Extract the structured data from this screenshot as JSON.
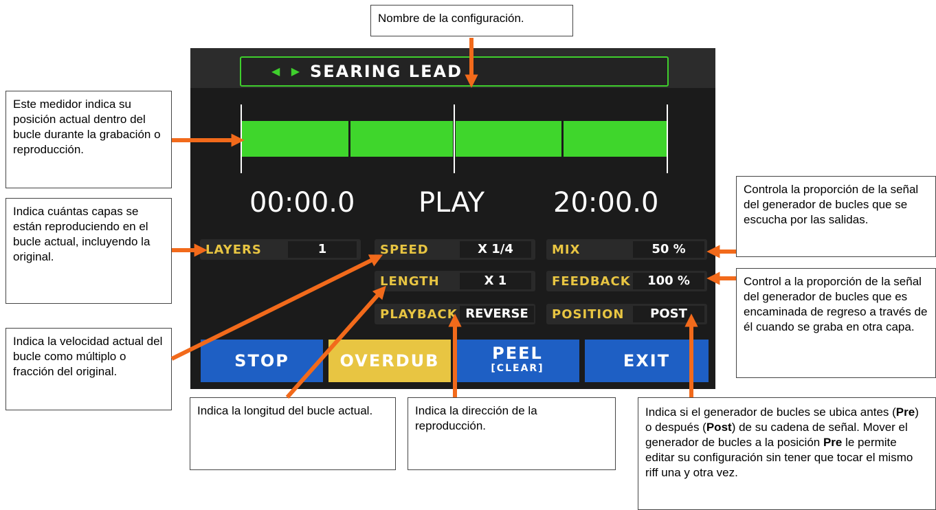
{
  "device": {
    "nav_arrows": "◀ ▶",
    "preset_name": "SEARING LEAD",
    "time_start": "00:00.0",
    "status": "PLAY",
    "time_end": "20:00.0",
    "params": [
      {
        "label": "LAYERS",
        "value": "1"
      },
      {
        "label": "SPEED",
        "value": "X 1/4"
      },
      {
        "label": "MIX",
        "value": "50 %"
      },
      {
        "label": "LENGTH",
        "value": "X 1"
      },
      {
        "label": "FEEDBACK",
        "value": "100 %"
      },
      {
        "label": "PLAYBACK",
        "value": "REVERSE"
      },
      {
        "label": "POSITION",
        "value": "POST"
      }
    ],
    "buttons": {
      "stop": "STOP",
      "overdub": "OVERDUB",
      "peel": "PEEL",
      "peel_sub": "[CLEAR]",
      "exit": "EXIT"
    },
    "progress_fraction": 1.0
  },
  "callouts": {
    "config_name": "Nombre de la configuración.",
    "meter": "Este medidor indica su posición actual dentro del bucle durante la grabación o reproducción.",
    "layers": "Indica cuántas capas se están reproduciendo en el bucle actual, incluyendo la original.",
    "speed": "Indica la velocidad actual del bucle como múltiplo o fracción del original.",
    "length": "Indica la longitud del bucle actual.",
    "playback": "Indica la dirección de la reproducción.",
    "mix": "Controla la proporción de la señal del generador de bucles que se escucha por las salidas.",
    "feedback": "Control a la proporción de la señal del generador de bucles que es encaminada de regreso a través de él cuando se graba en otra capa.",
    "position": {
      "t1": "Indica si el generador de bucles se ubica antes (",
      "b1": "Pre",
      "t2": ") o después (",
      "b2": "Post",
      "t3": ") de su cadena de señal. Mover el generador de bucles a la posición ",
      "b3": "Pre",
      "t4": " le permite editar su configuración sin tener que tocar el mismo riff una y otra vez."
    }
  },
  "colors": {
    "accent_green": "#3fcf2d",
    "label_yellow": "#e8c542",
    "button_blue": "#1e5fc4",
    "button_yellow": "#e8c542",
    "arrow_orange": "#f26a1b"
  }
}
